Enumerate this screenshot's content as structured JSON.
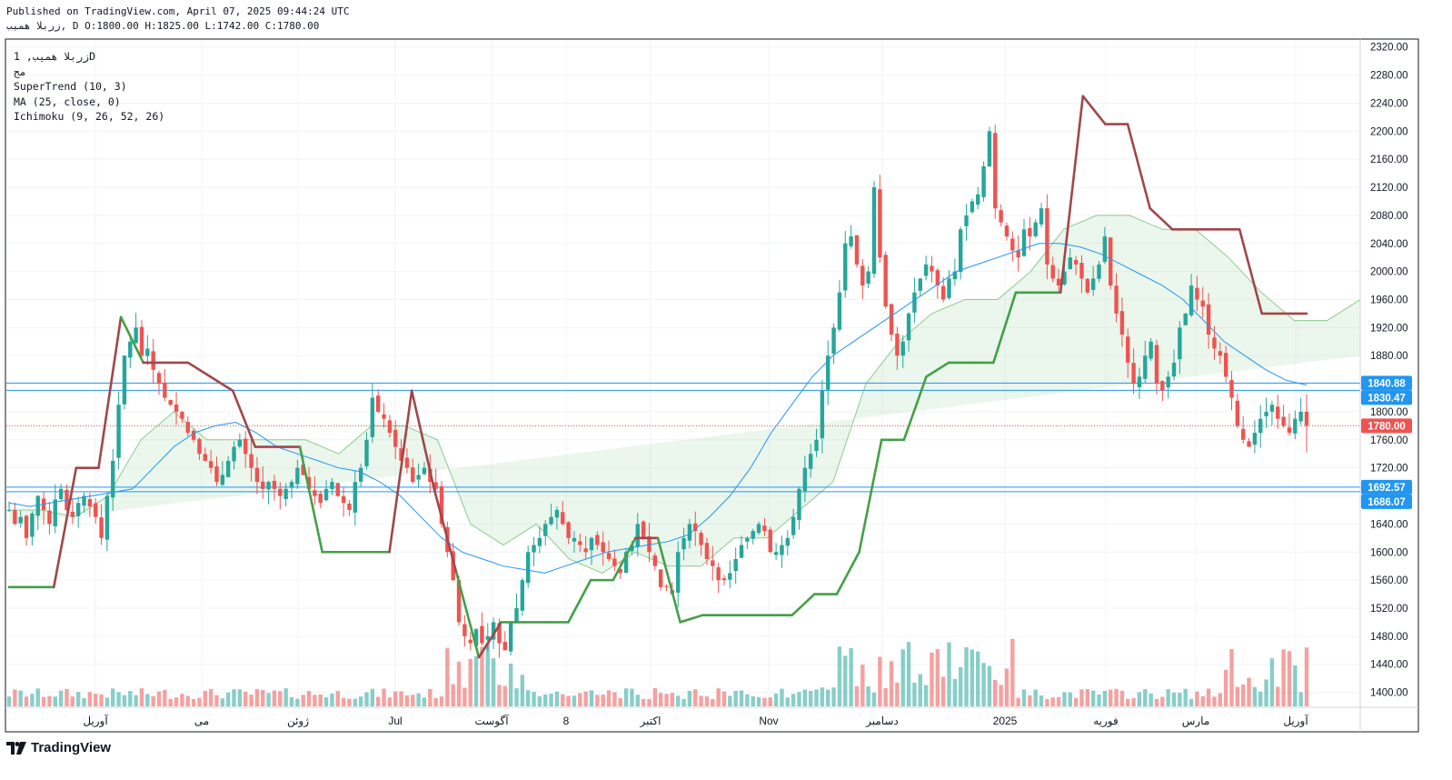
{
  "header": {
    "published": "Published on TradingView.com, April 07, 2025 09:44:24 UTC",
    "ohlc_line": "زربلا همیب, D O:1800.00 H:1825.00 L:1742.00 C:1780.00"
  },
  "legend": {
    "symbol": "زربلا همیب, 1D",
    "exchange": "مج",
    "indicators": [
      "SuperTrend (10, 3)",
      "MA (25, close, 0)",
      "Ichimoku (9, 26, 52, 26)"
    ]
  },
  "brand": {
    "name": "TradingView"
  },
  "colors": {
    "up": "#26a69a",
    "down": "#ef5350",
    "supertrend_up": "#43a047",
    "supertrend_down": "#a0474a",
    "ma": "#2196f3",
    "hline": "#2196f3",
    "last_price": "#ef5350"
  },
  "chart_data": {
    "type": "candlestick",
    "title": "زربلا همیب, 1D",
    "timeframe": "D",
    "ylim": [
      1380,
      2330
    ],
    "y_ticks": [
      1400,
      1440,
      1480,
      1520,
      1560,
      1600,
      1640,
      1680,
      1720,
      1760,
      1800,
      1840,
      1880,
      1920,
      1960,
      2000,
      2040,
      2080,
      2120,
      2160,
      2200,
      2240,
      2280,
      2320
    ],
    "x_labels": [
      "آوریل",
      "می",
      "ژوئن",
      "Jul",
      "آگوست",
      "8",
      "اکتبر",
      "Nov",
      "دسامبر",
      "2025",
      "فوریه",
      "مارس",
      "آوریل"
    ],
    "last_ohlc": {
      "open": 1800,
      "high": 1825,
      "low": 1742,
      "close": 1780
    },
    "price_labels": [
      {
        "value": 1840.88,
        "text": "1840.88",
        "kind": "hline"
      },
      {
        "value": 1830.47,
        "text": "1830.47",
        "kind": "hline"
      },
      {
        "value": 1780.0,
        "text": "1780.00",
        "kind": "last"
      },
      {
        "value": 1692.57,
        "text": "1692.57",
        "kind": "hline"
      },
      {
        "value": 1686.07,
        "text": "1686.07",
        "kind": "hline"
      }
    ],
    "horizontal_lines": [
      1840.88,
      1830.47,
      1692.57,
      1686.07
    ],
    "series": [
      {
        "name": "close",
        "values": [
          1660,
          1640,
          1650,
          1620,
          1655,
          1680,
          1660,
          1640,
          1675,
          1690,
          1660,
          1650,
          1670,
          1680,
          1665,
          1650,
          1620,
          1680,
          1730,
          1810,
          1880,
          1900,
          1920,
          1880,
          1890,
          1860,
          1840,
          1820,
          1810,
          1800,
          1790,
          1770,
          1760,
          1740,
          1730,
          1720,
          1700,
          1710,
          1730,
          1750,
          1760,
          1740,
          1720,
          1700,
          1690,
          1700,
          1690,
          1680,
          1690,
          1700,
          1720,
          1710,
          1690,
          1680,
          1670,
          1690,
          1700,
          1680,
          1670,
          1660,
          1700,
          1720,
          1760,
          1820,
          1800,
          1790,
          1770,
          1750,
          1730,
          1720,
          1700,
          1710,
          1720,
          1700,
          1690,
          1640,
          1600,
          1560,
          1500,
          1480,
          1470,
          1490,
          1470,
          1480,
          1500,
          1470,
          1460,
          1500,
          1520,
          1560,
          1600,
          1610,
          1620,
          1640,
          1650,
          1660,
          1640,
          1620,
          1620,
          1610,
          1600,
          1620,
          1610,
          1600,
          1590,
          1580,
          1570,
          1600,
          1610,
          1640,
          1620,
          1600,
          1580,
          1550,
          1550,
          1540,
          1600,
          1620,
          1640,
          1630,
          1610,
          1590,
          1580,
          1560,
          1560,
          1570,
          1590,
          1610,
          1620,
          1630,
          1640,
          1630,
          1600,
          1600,
          1610,
          1620,
          1650,
          1690,
          1720,
          1740,
          1760,
          1830,
          1880,
          1920,
          1970,
          2040,
          2050,
          2010,
          1980,
          2000,
          2120,
          2020,
          1950,
          1910,
          1880,
          1900,
          1940,
          1970,
          1990,
          2010,
          2000,
          1980,
          1960,
          1990,
          2000,
          2060,
          2080,
          2100,
          2110,
          2150,
          2200,
          2090,
          2070,
          2050,
          2030,
          2020,
          2060,
          2050,
          2070,
          2090,
          2010,
          1990,
          1980,
          2000,
          2020,
          2010,
          1990,
          1970,
          1990,
          2010,
          2050,
          1980,
          1940,
          1910,
          1870,
          1840,
          1850,
          1880,
          1900,
          1840,
          1830,
          1850,
          1870,
          1920,
          1940,
          1980,
          1960,
          1950,
          1910,
          1890,
          1880,
          1850,
          1820,
          1780,
          1760,
          1750,
          1770,
          1790,
          1800,
          1810,
          1790,
          1780,
          1770,
          1790,
          1800,
          1780
        ]
      },
      {
        "name": "MA (25, close, 0)",
        "values": [
          1670,
          1665,
          1670,
          1675,
          1680,
          1685,
          1690,
          1720,
          1750,
          1770,
          1780,
          1785,
          1770,
          1750,
          1740,
          1730,
          1720,
          1715,
          1700,
          1680,
          1650,
          1620,
          1600,
          1590,
          1580,
          1575,
          1570,
          1580,
          1590,
          1600,
          1605,
          1610,
          1615,
          1625,
          1650,
          1680,
          1720,
          1770,
          1810,
          1850,
          1880,
          1900,
          1920,
          1940,
          1960,
          1980,
          2000,
          2010,
          2020,
          2030,
          2040,
          2040,
          2035,
          2025,
          2010,
          1995,
          1980,
          1960,
          1930,
          1900,
          1880,
          1860,
          1845,
          1838
        ]
      },
      {
        "name": "SuperTrend (10, 3)",
        "values": [
          1550,
          1550,
          1550,
          1720,
          1720,
          1935,
          1870,
          1870,
          1870,
          1850,
          1830,
          1750,
          1750,
          1750,
          1600,
          1600,
          1600,
          1600,
          1830,
          1690,
          1570,
          1450,
          1500,
          1500,
          1500,
          1500,
          1560,
          1560,
          1620,
          1620,
          1500,
          1510,
          1510,
          1510,
          1510,
          1510,
          1540,
          1540,
          1600,
          1760,
          1760,
          1850,
          1870,
          1870,
          1870,
          1970,
          1970,
          1970,
          2250,
          2210,
          2210,
          2090,
          2060,
          2060,
          2060,
          2060,
          1940,
          1940,
          1940
        ]
      },
      {
        "name": "Ichimoku (9, 26, 52, 26)",
        "values": [
          1660,
          1660,
          1650,
          1680,
          1760,
          1800,
          1760,
          1760,
          1760,
          1760,
          1740,
          1780,
          1780,
          1760,
          1640,
          1610,
          1640,
          1590,
          1570,
          1600,
          1580,
          1580,
          1620,
          1620,
          1660,
          1700,
          1840,
          1900,
          1940,
          1960,
          1960,
          2000,
          2060,
          2080,
          2080,
          2060,
          2060,
          2020,
          1970,
          1930,
          1930,
          1960
        ]
      }
    ]
  }
}
